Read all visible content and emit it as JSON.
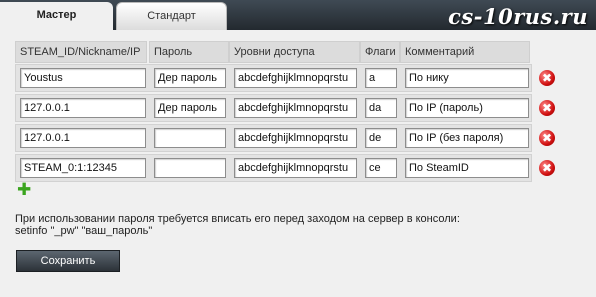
{
  "tabs": [
    {
      "label": "Мастер",
      "active": true
    },
    {
      "label": "Стандарт",
      "active": false
    }
  ],
  "watermark": "cs-10rus.ru",
  "table": {
    "headers": [
      "STEAM_ID/Nickname/IP",
      "Пароль",
      "Уровни доступа",
      "Флаги",
      "Комментарий"
    ],
    "rows": [
      {
        "id": "Youstus",
        "password": "Дер пароль",
        "access": "abcdefghijklmnopqrstu",
        "flags": "a",
        "comment": "По нику"
      },
      {
        "id": "127.0.0.1",
        "password": "Дер пароль",
        "access": "abcdefghijklmnopqrstu",
        "flags": "da",
        "comment": "По IP (пароль)"
      },
      {
        "id": "127.0.0.1",
        "password": "",
        "access": "abcdefghijklmnopqrstu",
        "flags": "de",
        "comment": "По IP (без пароля)"
      },
      {
        "id": "STEAM_0:1:12345",
        "password": "",
        "access": "abcdefghijklmnopqrstu",
        "flags": "ce",
        "comment": "По SteamID"
      }
    ]
  },
  "icons": {
    "delete": "delete-x-icon",
    "add": "add-plus-icon"
  },
  "hint": {
    "line1": "При использовании пароля требуется вписать его перед заходом на сервер в консоли:",
    "line2": "setinfo \"_pw\" \"ваш_пароль\""
  },
  "save_label": "Сохранить",
  "colors": {
    "delete": "#d01010",
    "add": "#3aa41e",
    "topbar": "#2d343b"
  }
}
